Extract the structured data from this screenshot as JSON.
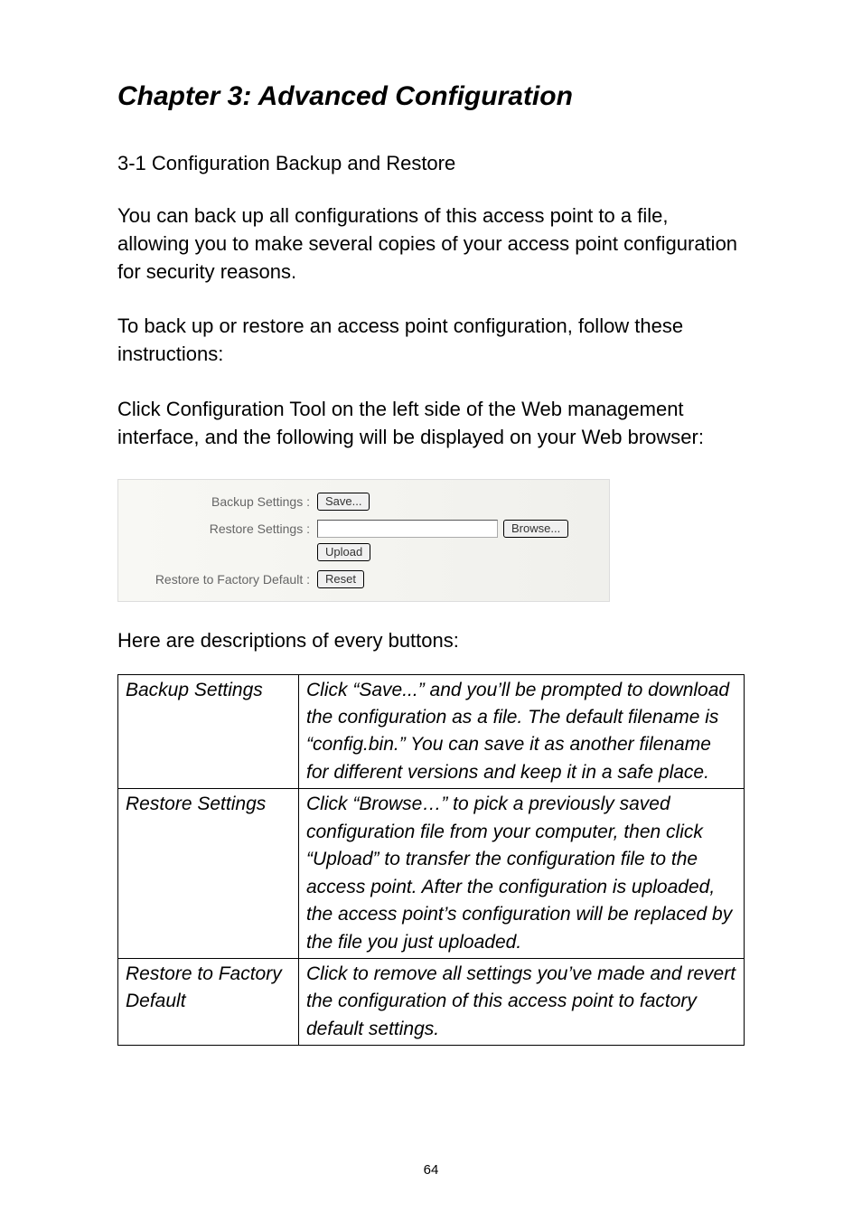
{
  "chapter_title": "Chapter 3: Advanced Configuration",
  "section_heading": "3-1 Configuration Backup and Restore",
  "para1": "You can back up all configurations of this access point to a file, allowing you to make several copies of your access point configuration for security reasons.",
  "para2": "To back up or restore an access point configuration, follow these instructions:",
  "para3": "Click Configuration Tool on the left side of the Web management interface, and the following will be displayed on your Web browser:",
  "screenshot": {
    "backup_label": "Backup Settings :",
    "save_btn": "Save...",
    "restore_label": "Restore Settings :",
    "browse_btn": "Browse...",
    "upload_btn": "Upload",
    "factory_label": "Restore to Factory Default :",
    "reset_btn": "Reset"
  },
  "desc_intro": "Here are descriptions of every buttons:",
  "table": {
    "rows": [
      {
        "name": "Backup Settings",
        "desc": "Click “Save...” and you’ll be prompted to download the configuration as a file. The default filename is “config.bin.” You can save it as another filename for different versions and keep it in a safe place."
      },
      {
        "name": "Restore Settings",
        "desc": "Click “Browse…” to pick a previously saved configuration file from your computer, then click “Upload” to transfer the configuration file to the access point. After the configuration is uploaded, the access point’s configuration will be replaced by the file you just uploaded."
      },
      {
        "name": "Restore to Factory Default",
        "desc": "Click to remove all settings you’ve made and revert the configuration of this access point to factory default settings."
      }
    ]
  },
  "page_number": "64"
}
